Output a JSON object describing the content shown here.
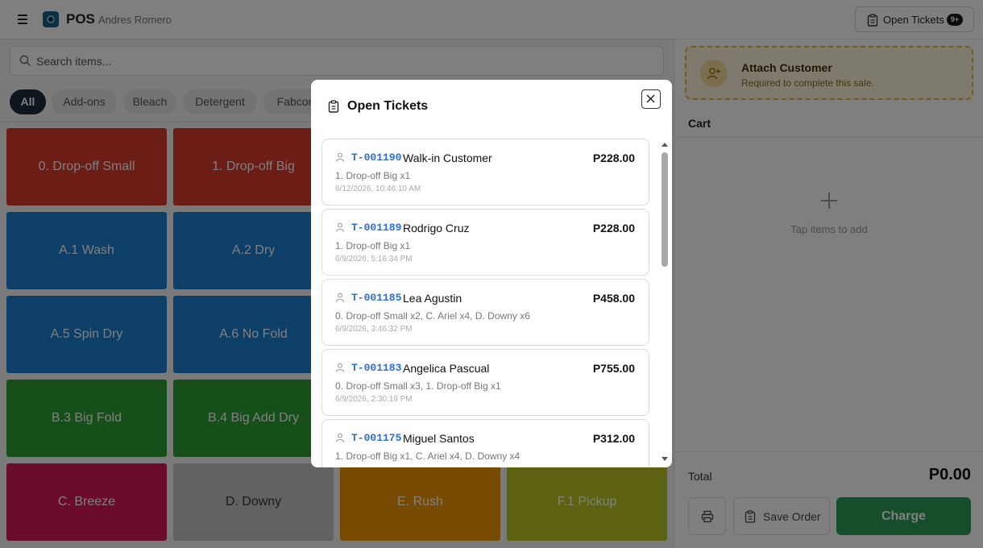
{
  "header": {
    "app_title": "POS",
    "user_name": "Andres Romero",
    "open_tickets_label": "Open Tickets",
    "open_tickets_badge": "9+",
    "icons": [
      "menu-icon",
      "app-logo",
      "clipboard-icon"
    ]
  },
  "search": {
    "placeholder": "Search items...",
    "value": ""
  },
  "categories": [
    {
      "label": "All",
      "active": true
    },
    {
      "label": "Add-ons",
      "active": false
    },
    {
      "label": "Bleach",
      "active": false
    },
    {
      "label": "Detergent",
      "active": false
    },
    {
      "label": "Fabcon",
      "active": false
    }
  ],
  "items": [
    {
      "label": "0. Drop-off Small",
      "color": "#d73a2c"
    },
    {
      "label": "1. Drop-off Big",
      "color": "#d73a2c"
    },
    {
      "label": "A.1 Wash",
      "color": "#1a7fd2"
    },
    {
      "label": "A.2 Dry",
      "color": "#1a7fd2"
    },
    {
      "label": "A.5 Spin Dry",
      "color": "#1a7fd2"
    },
    {
      "label": "A.6 No Fold",
      "color": "#1a7fd2"
    },
    {
      "label": "B.3 Big Fold",
      "color": "#2f9e35"
    },
    {
      "label": "B.4 Big Add Dry",
      "color": "#2f9e35"
    },
    {
      "label": "C. Breeze",
      "color": "#d6195f"
    },
    {
      "label": "D. Downy",
      "color": "#c4c4c4"
    },
    {
      "label": "E. Rush",
      "color": "#ef9400"
    },
    {
      "label": "F.1 Pickup",
      "color": "#b8c41e"
    }
  ],
  "cart": {
    "attach_title": "Attach Customer",
    "attach_subtitle": "Required to complete this sale.",
    "heading": "Cart",
    "empty_text": "Tap items to add",
    "total_label": "Total",
    "total_value": "P0.00",
    "save_label": "Save Order",
    "charge_label": "Charge"
  },
  "modal": {
    "title": "Open Tickets",
    "tickets": [
      {
        "id": "T-001190",
        "customer": "Walk-in Customer",
        "amount": "P228.00",
        "items": "1. Drop-off Big x1",
        "time": "6/12/2026, 10:46:10 AM"
      },
      {
        "id": "T-001189",
        "customer": "Rodrigo Cruz",
        "amount": "P228.00",
        "items": "1. Drop-off Big x1",
        "time": "6/9/2026, 5:16:34 PM"
      },
      {
        "id": "T-001185",
        "customer": "Lea Agustin",
        "amount": "P458.00",
        "items": "0. Drop-off Small x2, C. Ariel x4, D. Downy x6",
        "time": "6/9/2026, 3:46:32 PM"
      },
      {
        "id": "T-001183",
        "customer": "Angelica Pascual",
        "amount": "P755.00",
        "items": "0. Drop-off Small x3, 1. Drop-off Big x1",
        "time": "6/9/2026, 2:30:19 PM"
      },
      {
        "id": "T-001175",
        "customer": "Miguel Santos",
        "amount": "P312.00",
        "items": "1. Drop-off Big x1, C. Ariel x4, D. Downy x4",
        "time": ""
      }
    ]
  },
  "colors": {
    "accent_dark": "#1c2b3a",
    "charge_green": "#2c9b57",
    "ticket_id_blue": "#2a6fd6",
    "attach_border": "#e6b63a"
  }
}
